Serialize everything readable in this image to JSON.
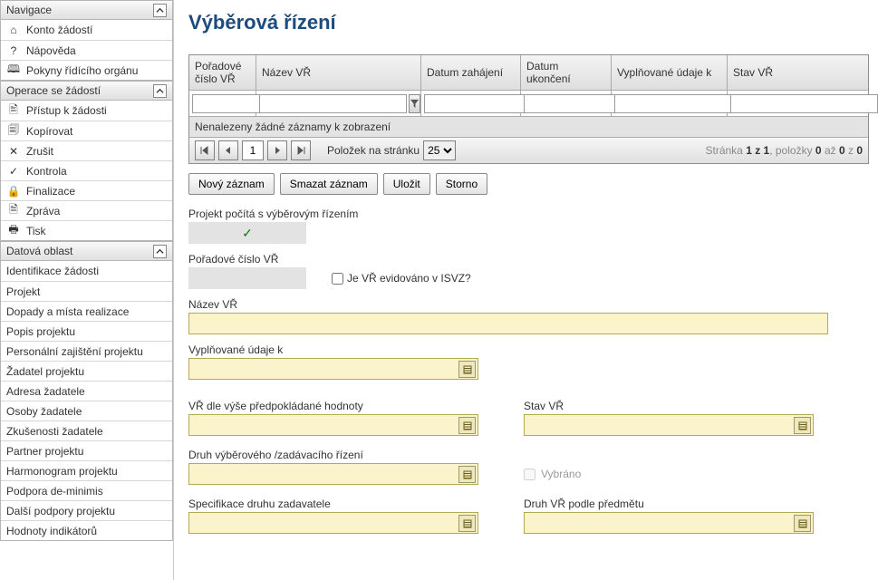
{
  "sidebar": {
    "groups": [
      {
        "title": "Navigace",
        "items": [
          {
            "icon": "⌂",
            "label": "Konto žádostí"
          },
          {
            "icon": "?",
            "label": "Nápověda"
          },
          {
            "icon": "🕮",
            "label": "Pokyny řídícího orgánu"
          }
        ]
      },
      {
        "title": "Operace se žádostí",
        "items": [
          {
            "icon": "🖹",
            "label": "Přístup k žádosti"
          },
          {
            "icon": "🗐",
            "label": "Kopírovat"
          },
          {
            "icon": "✕",
            "label": "Zrušit"
          },
          {
            "icon": "✓",
            "label": "Kontrola"
          },
          {
            "icon": "🔒",
            "label": "Finalizace"
          },
          {
            "icon": "🗎",
            "label": "Zpráva"
          },
          {
            "icon": "🖶",
            "label": "Tisk"
          }
        ]
      },
      {
        "title": "Datová oblast",
        "items": [
          {
            "icon": "",
            "label": "Identifikace žádosti"
          },
          {
            "icon": "",
            "label": "Projekt"
          },
          {
            "icon": "",
            "label": "Dopady a místa realizace"
          },
          {
            "icon": "",
            "label": "Popis projektu"
          },
          {
            "icon": "",
            "label": "Personální zajištění projektu"
          },
          {
            "icon": "",
            "label": "Žadatel projektu"
          },
          {
            "icon": "",
            "label": "Adresa žadatele"
          },
          {
            "icon": "",
            "label": "Osoby žadatele"
          },
          {
            "icon": "",
            "label": "Zkušenosti žadatele"
          },
          {
            "icon": "",
            "label": "Partner projektu"
          },
          {
            "icon": "",
            "label": "Harmonogram projektu"
          },
          {
            "icon": "",
            "label": "Podpora de-minimis"
          },
          {
            "icon": "",
            "label": "Další podpory projektu"
          },
          {
            "icon": "",
            "label": "Hodnoty indikátorů"
          }
        ]
      }
    ]
  },
  "pageTitle": "Výběrová řízení",
  "grid": {
    "columns": [
      "Pořadové číslo VŘ",
      "Název VŘ",
      "Datum zahájení",
      "Datum ukončení",
      "Vyplňované údaje k",
      "Stav VŘ"
    ],
    "emptyText": "Nenalezeny žádné záznamy k zobrazení",
    "pager": {
      "current": "1",
      "perPageLabel": "Položek na stránku",
      "perPage": "25",
      "infoPrefix": "Stránka ",
      "pages": "1 z 1",
      "itemsPrefix": ", položky ",
      "itemsFrom": "0",
      "mid": " až ",
      "itemsTo": "0",
      "tail": " z ",
      "total": "0"
    }
  },
  "actions": {
    "new": "Nový záznam",
    "delete": "Smazat záznam",
    "save": "Uložit",
    "cancel": "Storno"
  },
  "form": {
    "procLabel": "Projekt počítá s výběrovým řízením",
    "seqLabel": "Pořadové číslo VŘ",
    "isvzLabel": "Je VŘ evidováno v ISVZ?",
    "nameLabel": "Název VŘ",
    "dataLabel": "Vyplňované údaje k",
    "heightLabel": "VŘ dle výše předpokládané hodnoty",
    "stateLabel": "Stav VŘ",
    "typeLabel": "Druh výběrového /zadávacího řízení",
    "selectedLabel": "Vybráno",
    "specLabel": "Specifikace druhu zadavatele",
    "subjectLabel": "Druh VŘ podle předmětu"
  }
}
